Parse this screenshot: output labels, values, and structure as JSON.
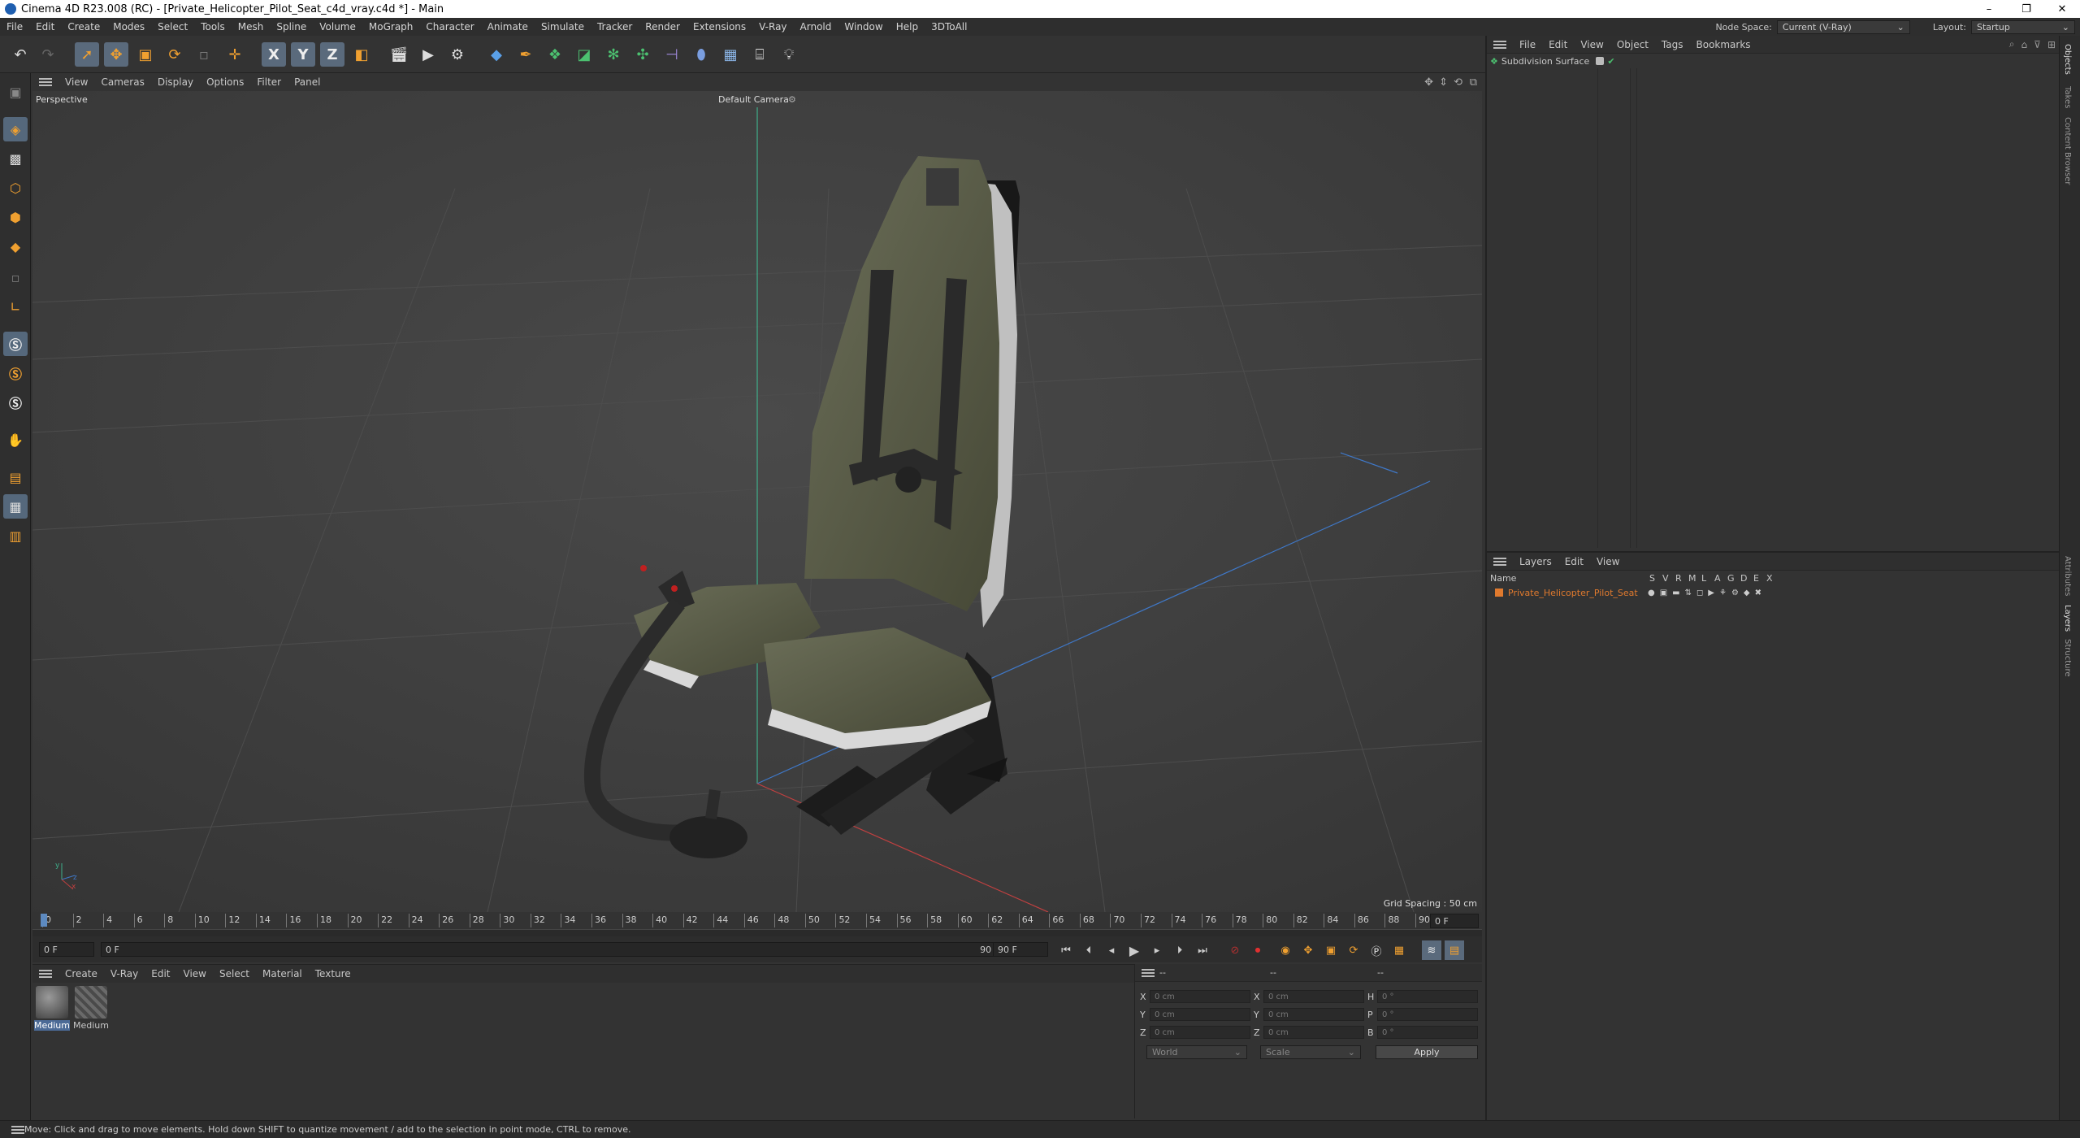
{
  "window": {
    "title": "Cinema 4D R23.008 (RC) - [Private_Helicopter_Pilot_Seat_c4d_vray.c4d *] - Main",
    "controls": [
      "–",
      "❐",
      "✕"
    ]
  },
  "menubar": {
    "items": [
      "File",
      "Edit",
      "Create",
      "Modes",
      "Select",
      "Tools",
      "Mesh",
      "Spline",
      "Volume",
      "MoGraph",
      "Character",
      "Animate",
      "Simulate",
      "Tracker",
      "Render",
      "Extensions",
      "V-Ray",
      "Arnold",
      "Window",
      "Help",
      "3DToAll"
    ],
    "node_space_label": "Node Space:",
    "node_space_value": "Current (V-Ray)",
    "layout_label": "Layout:",
    "layout_value": "Startup"
  },
  "toolbar": {
    "axis_x": "X",
    "axis_y": "Y",
    "axis_z": "Z"
  },
  "viewport": {
    "menu": [
      "View",
      "Cameras",
      "Display",
      "Options",
      "Filter",
      "Panel"
    ],
    "view_name": "Perspective",
    "camera_label": "Default Camera",
    "grid_spacing": "Grid Spacing : 50 cm",
    "axis_y": "y",
    "axis_z": "z",
    "axis_x": "x"
  },
  "timeline": {
    "ticks": [
      "0",
      "2",
      "4",
      "6",
      "8",
      "10",
      "12",
      "14",
      "16",
      "18",
      "20",
      "22",
      "24",
      "26",
      "28",
      "30",
      "32",
      "34",
      "36",
      "38",
      "40",
      "42",
      "44",
      "46",
      "48",
      "50",
      "52",
      "54",
      "56",
      "58",
      "60",
      "62",
      "64",
      "66",
      "68",
      "70",
      "72",
      "74",
      "76",
      "78",
      "80",
      "82",
      "84",
      "86",
      "88",
      "90"
    ],
    "end_field": "0 F"
  },
  "transport": {
    "current": "0 F",
    "start": "0 F",
    "end_a": "90 F",
    "end_b": "90 F"
  },
  "materials": {
    "menu": [
      "Create",
      "V-Ray",
      "Edit",
      "View",
      "Select",
      "Material",
      "Texture"
    ],
    "items": [
      {
        "name": "Medium"
      },
      {
        "name": "Medium"
      }
    ]
  },
  "coords": {
    "rows": [
      {
        "a": "X",
        "a_val": "0 cm",
        "b": "X",
        "b_val": "0 cm",
        "c": "H",
        "c_val": "0 °"
      },
      {
        "a": "Y",
        "a_val": "0 cm",
        "b": "Y",
        "b_val": "0 cm",
        "c": "P",
        "c_val": "0 °"
      },
      {
        "a": "Z",
        "a_val": "0 cm",
        "b": "Z",
        "b_val": "0 cm",
        "c": "B",
        "c_val": "0 °"
      }
    ],
    "head_a": "--",
    "head_b": "--",
    "head_c": "--",
    "world": "World",
    "scale": "Scale",
    "apply": "Apply"
  },
  "objects": {
    "menu": [
      "File",
      "Edit",
      "View",
      "Object",
      "Tags",
      "Bookmarks"
    ],
    "items": [
      {
        "name": "Subdivision Surface"
      }
    ]
  },
  "layers": {
    "menu": [
      "Layers",
      "Edit",
      "View"
    ],
    "col_name": "Name",
    "cols": [
      "S",
      "V",
      "R",
      "M",
      "L",
      "A",
      "G",
      "D",
      "E",
      "X"
    ],
    "items": [
      {
        "name": "Private_Helicopter_Pilot_Seat",
        "color": "#e07a2e"
      }
    ]
  },
  "sidetabs": [
    "Objects",
    "Takes",
    "Content Browser",
    "Attributes",
    "Layers",
    "Structure"
  ],
  "status": "Move: Click and drag to move elements. Hold down SHIFT to quantize movement / add to the selection in point mode, CTRL to remove.",
  "colors": {
    "accent": "#e07a2e",
    "selection": "#5a6a7c",
    "timeline_marker": "#5d8ac0"
  }
}
